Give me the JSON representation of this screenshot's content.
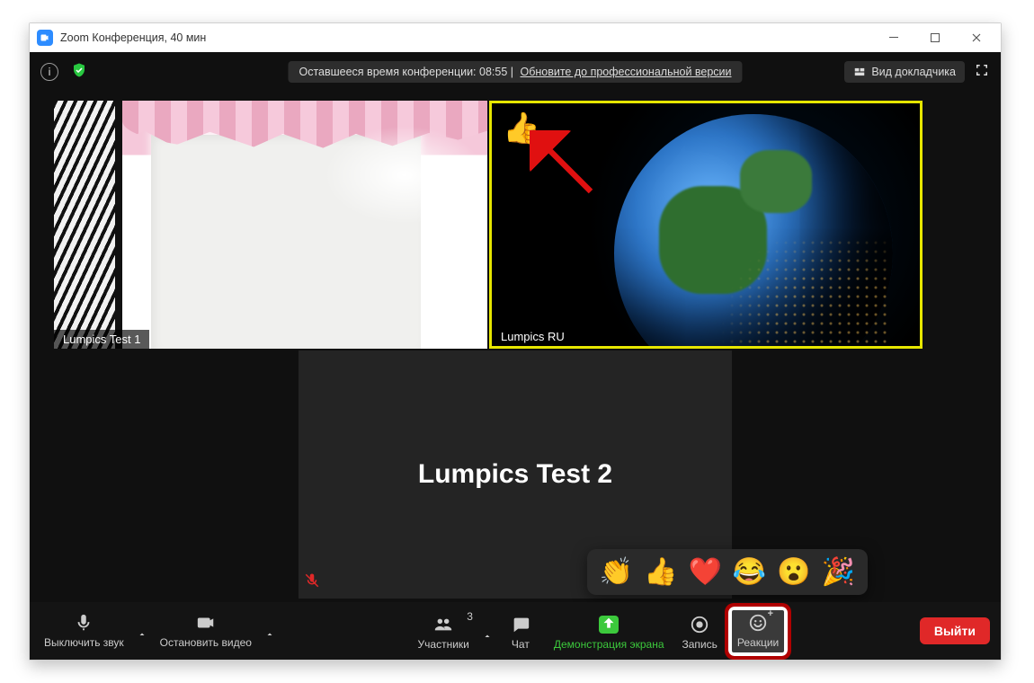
{
  "window": {
    "title": "Zoom Конференция, 40 мин"
  },
  "topbar": {
    "timer_text": "Оставшееся время конференции: 08:55",
    "upgrade_text": "Обновите до профессиональной версии",
    "speaker_view": "Вид докладчика"
  },
  "participants": {
    "tile1_name": "Lumpics Test 1",
    "tile2_name": "Lumpics RU",
    "tile3_name": "Lumpics Test 2",
    "tile2_reaction": "👍"
  },
  "toolbar": {
    "mute": "Выключить звук",
    "stop_video": "Остановить видео",
    "participants": "Участники",
    "participants_count": "3",
    "chat": "Чат",
    "share": "Демонстрация экрана",
    "record": "Запись",
    "reactions": "Реакции",
    "leave": "Выйти"
  },
  "reactions_popup": [
    "👏",
    "👍",
    "❤️",
    "😂",
    "😮",
    "🎉"
  ]
}
